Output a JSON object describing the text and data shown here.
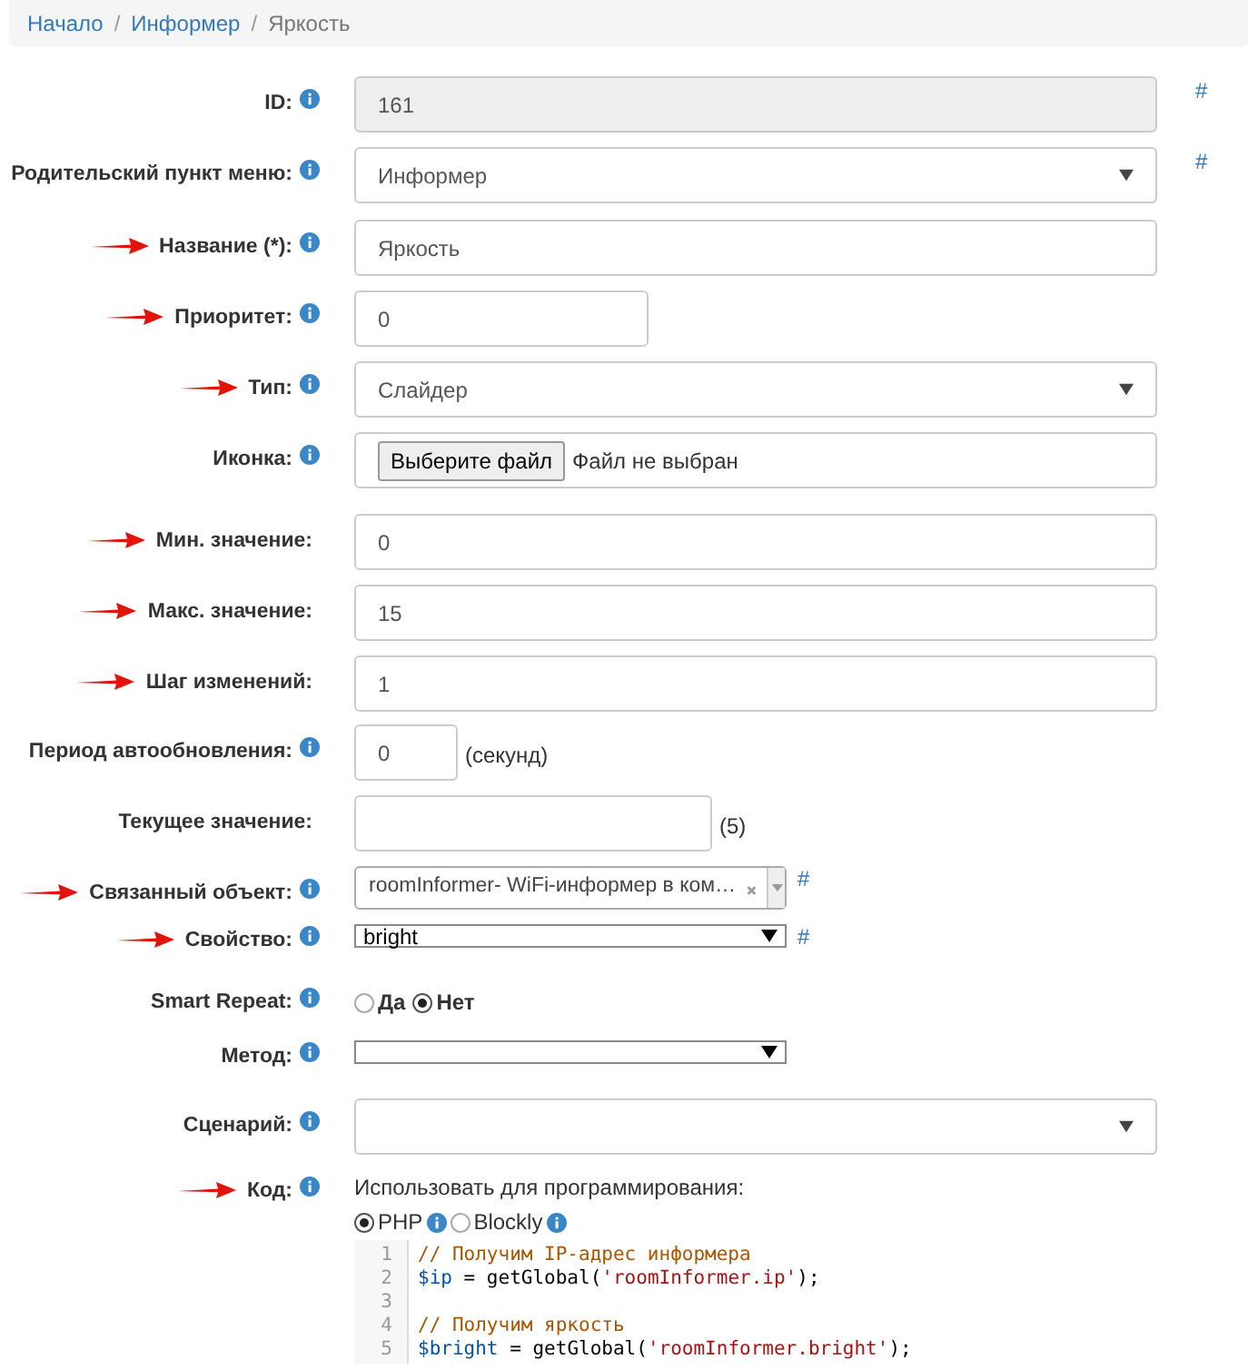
{
  "breadcrumb": [
    {
      "kind": "link",
      "label": "Начало"
    },
    {
      "kind": "separator",
      "label": "/"
    },
    {
      "kind": "link",
      "label": "Информер"
    },
    {
      "kind": "separator",
      "label": "/"
    },
    {
      "kind": "current",
      "label": "Яркость"
    }
  ],
  "fields": [
    {
      "kind": "readonly",
      "label": "ID:",
      "info": true,
      "arrow": false,
      "value": "161",
      "hash": "#"
    },
    {
      "kind": "select",
      "label": "Родительский пункт меню:",
      "info": true,
      "arrow": false,
      "value": "Информер",
      "hash": "#"
    },
    {
      "kind": "text",
      "label": "Название (*):",
      "info": true,
      "arrow": true,
      "value": "Яркость"
    },
    {
      "kind": "short",
      "label": "Приоритет:",
      "info": true,
      "arrow": true,
      "value": "0"
    },
    {
      "kind": "select",
      "label": "Тип:",
      "info": true,
      "arrow": true,
      "value": "Слайдер"
    },
    {
      "kind": "file",
      "label": "Иконка:",
      "info": true,
      "arrow": false,
      "button": "Выберите файл",
      "status": "Файл не выбран"
    },
    {
      "kind": "text",
      "label": "Мин. значение:",
      "info": false,
      "arrow": true,
      "value": "0"
    },
    {
      "kind": "text",
      "label": "Макс. значение:",
      "info": false,
      "arrow": true,
      "value": "15"
    },
    {
      "kind": "text",
      "label": "Шаг изменений:",
      "info": false,
      "arrow": true,
      "value": "1"
    },
    {
      "kind": "tiny",
      "label": "Период автообновления:",
      "info": true,
      "arrow": false,
      "value": "0",
      "suffix": "(секунд)"
    },
    {
      "kind": "medium",
      "label": "Текущее значение:",
      "info": false,
      "arrow": false,
      "suffix": "(5)"
    },
    {
      "kind": "combo",
      "label": "Связанный объект:",
      "info": true,
      "arrow": true,
      "value": "roomInformer- WiFi-информер в ком…",
      "hash": "#"
    },
    {
      "kind": "native",
      "label": "Свойство:",
      "info": true,
      "arrow": true,
      "value": "bright",
      "hash": "#"
    },
    {
      "kind": "radio",
      "label": "Smart Repeat:",
      "info": true,
      "arrow": false,
      "options": [
        {
          "label": "Да",
          "selected": false
        },
        {
          "label": "Нет",
          "selected": true
        }
      ]
    },
    {
      "kind": "native",
      "label": "Метод:",
      "info": true,
      "arrow": false
    },
    {
      "kind": "select",
      "label": "Сценарий:",
      "info": true,
      "arrow": false
    },
    {
      "kind": "code",
      "label": "Код:",
      "info": true,
      "arrow": true,
      "caption": "Использовать для программирования:",
      "modes": [
        {
          "label": "PHP",
          "selected": true,
          "info": true
        },
        {
          "label": "Blockly",
          "selected": false,
          "info": true
        }
      ],
      "lines": [
        {
          "number": "1",
          "tokens": [
            {
              "kind": "comment",
              "text": "// Получим IP-адрес информера"
            }
          ]
        },
        {
          "number": "2",
          "tokens": [
            {
              "kind": "var",
              "text": "$ip"
            },
            {
              "kind": "plain",
              "text": " = getGlobal("
            },
            {
              "kind": "string",
              "text": "'roomInformer.ip'"
            },
            {
              "kind": "plain",
              "text": ");"
            }
          ]
        },
        {
          "number": "3"
        },
        {
          "number": "4",
          "tokens": [
            {
              "kind": "comment",
              "text": "// Получим яркость"
            }
          ]
        },
        {
          "number": "5",
          "tokens": [
            {
              "kind": "var",
              "text": "$bright"
            },
            {
              "kind": "plain",
              "text": " = getGlobal("
            },
            {
              "kind": "string",
              "text": "'roomInformer.bright'"
            },
            {
              "kind": "plain",
              "text": ");"
            }
          ]
        }
      ]
    }
  ]
}
